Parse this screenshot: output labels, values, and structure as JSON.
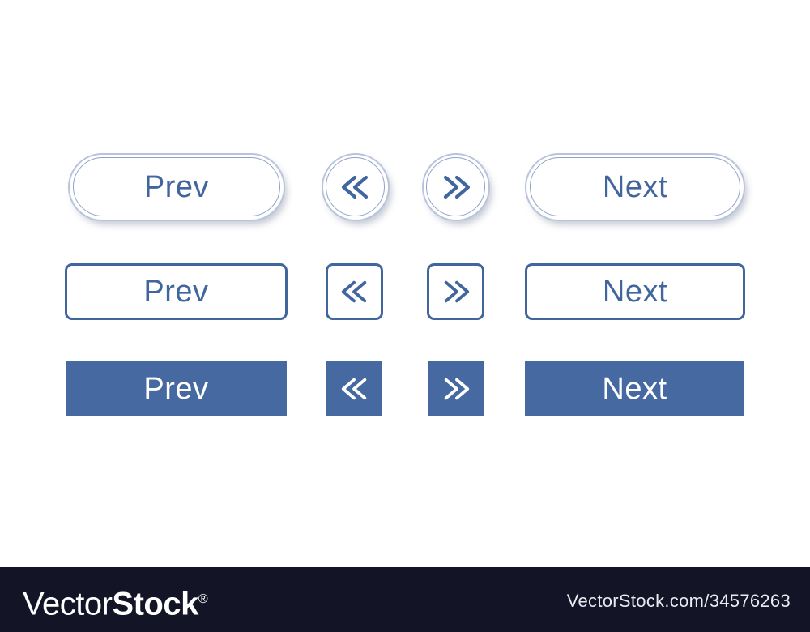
{
  "canvas": {
    "background": "#ffffff",
    "accent_blue": "#41669e",
    "solid_blue": "#4569a0",
    "soft_border": "#b9c4dc",
    "footer_bg": "#131426"
  },
  "button_sets": [
    {
      "style_name": "3d-shadow-pill",
      "buttons": [
        {
          "name": "prev",
          "label": "Prev",
          "icon": null,
          "shape": "pill"
        },
        {
          "name": "first",
          "label": "",
          "icon": "double-chevron-left-icon",
          "shape": "circle"
        },
        {
          "name": "last",
          "label": "",
          "icon": "double-chevron-right-icon",
          "shape": "circle"
        },
        {
          "name": "next",
          "label": "Next",
          "icon": null,
          "shape": "pill"
        }
      ]
    },
    {
      "style_name": "outlined",
      "buttons": [
        {
          "name": "prev",
          "label": "Prev",
          "icon": null,
          "shape": "rounded-rect"
        },
        {
          "name": "first",
          "label": "",
          "icon": "double-chevron-left-icon",
          "shape": "rounded-square"
        },
        {
          "name": "last",
          "label": "",
          "icon": "double-chevron-right-icon",
          "shape": "rounded-square"
        },
        {
          "name": "next",
          "label": "Next",
          "icon": null,
          "shape": "rounded-rect"
        }
      ]
    },
    {
      "style_name": "solid-filled",
      "buttons": [
        {
          "name": "prev",
          "label": "Prev",
          "icon": null,
          "shape": "rect"
        },
        {
          "name": "first",
          "label": "",
          "icon": "double-chevron-left-icon",
          "shape": "square"
        },
        {
          "name": "last",
          "label": "",
          "icon": "double-chevron-right-icon",
          "shape": "square"
        },
        {
          "name": "next",
          "label": "Next",
          "icon": null,
          "shape": "rect"
        }
      ]
    }
  ],
  "watermark": {
    "brand_light": "Vector",
    "brand_bold": "Stock",
    "registered_mark": "®",
    "url": "VectorStock.com/34576263"
  }
}
